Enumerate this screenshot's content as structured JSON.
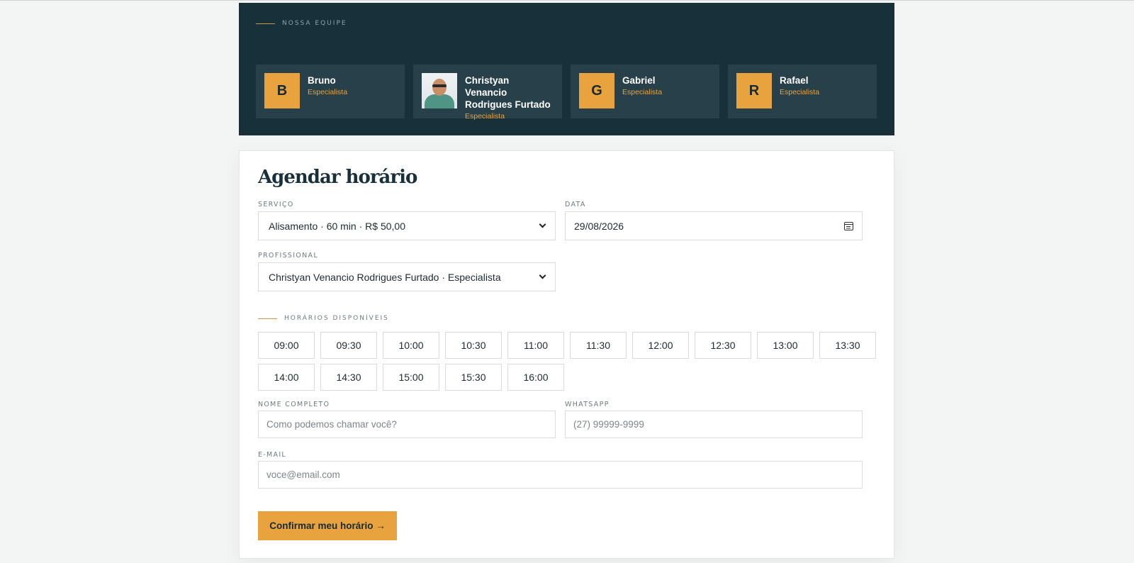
{
  "team": {
    "eyebrow": "NOSSA EQUIPE",
    "members": [
      {
        "initial": "B",
        "name": "Bruno",
        "role": "Especialista"
      },
      {
        "initial": "",
        "name": "Christyan Venancio Rodrigues Furtado",
        "role": "Especialista"
      },
      {
        "initial": "G",
        "name": "Gabriel",
        "role": "Especialista"
      },
      {
        "initial": "R",
        "name": "Rafael",
        "role": "Especialista"
      }
    ]
  },
  "booking": {
    "title": "Agendar horário",
    "service": {
      "label": "SERVIÇO",
      "value": "Alisamento · 60 min · R$ 50,00"
    },
    "date": {
      "label": "DATA",
      "value": "29/08/2026"
    },
    "professional": {
      "label": "PROFISSIONAL",
      "value": "Christyan Venancio Rodrigues Furtado · Especialista"
    },
    "slots_eyebrow": "HORÁRIOS DISPONÍVEIS",
    "slots": [
      "09:00",
      "09:30",
      "10:00",
      "10:30",
      "11:00",
      "11:30",
      "12:00",
      "12:30",
      "13:00",
      "13:30",
      "14:00",
      "14:30",
      "15:00",
      "15:30",
      "16:00"
    ],
    "name": {
      "label": "NOME COMPLETO",
      "placeholder": "Como podemos chamar você?"
    },
    "whatsapp": {
      "label": "WHATSAPP",
      "placeholder": "(27) 99999-9999"
    },
    "email": {
      "label": "E-MAIL",
      "placeholder": "voce@email.com"
    },
    "submit_label": "Confirmar meu horário →"
  },
  "colors": {
    "team_bg": "#18303a",
    "card_bg": "#27404a",
    "accent": "#e8a33e",
    "page_bg": "#f3f4f4"
  },
  "icons": {
    "select_arrow": "chevron-down-icon",
    "date_picker": "calendar-icon"
  }
}
